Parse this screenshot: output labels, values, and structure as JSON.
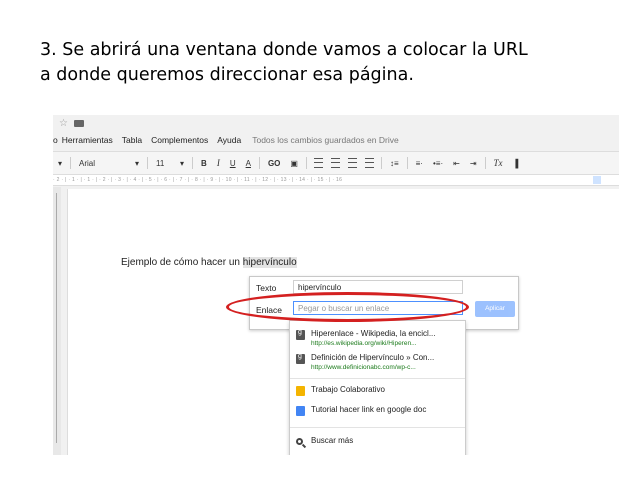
{
  "slide": {
    "line1": "3. Se abrirá una ventana donde vamos a colocar la URL",
    "line2": "a donde queremos direccionar esa página."
  },
  "docs": {
    "topicons": {
      "star": "☆"
    },
    "menu": {
      "partial": "o",
      "items": [
        "Herramientas",
        "Tabla",
        "Complementos",
        "Ayuda"
      ],
      "saved": "Todos los cambios guardados en Drive"
    },
    "toolbar": {
      "font": "Arial",
      "size": "11",
      "bold": "B",
      "italic": "I",
      "underline": "U",
      "color": "A",
      "link": "GO",
      "clear": "Tx"
    },
    "ruler": "· 2 · | · 1 · | · 1 · | · 2 · | · 3 · | · 4 · | · 5 · | · 6 · | · 7 · | · 8 · | · 9 · | · 10 · | · 11 · | · 12 · | · 13 · | · 14 · | · 15 · | · 16",
    "doc_text": "Ejemplo de cómo hacer un ",
    "doc_highlight": "hipervínculo",
    "link_popup": {
      "texto_label": "Texto",
      "texto_value": "hipervínculo",
      "enlace_label": "Enlace",
      "enlace_placeholder": "Pegar o buscar un enlace",
      "apply_label": "Aplicar"
    },
    "suggestions": [
      {
        "icon": "google-icon",
        "title": "Hiperenlace - Wikipedia, la encicl...",
        "url": "http://es.wikipedia.org/wiki/Hiperen..."
      },
      {
        "icon": "google-icon",
        "title": "Definición de Hipervínculo » Con...",
        "url": "http://www.definicionabc.com/wp-c..."
      },
      {
        "icon": "slides-icon",
        "title": "Trabajo Colaborativo"
      },
      {
        "icon": "docs-icon",
        "title": "Tutorial hacer link en google doc"
      },
      {
        "icon": "search-icon",
        "title": "Buscar más"
      }
    ],
    "colors": {
      "accent": "#4d90fe",
      "annotation": "#d42020"
    }
  }
}
